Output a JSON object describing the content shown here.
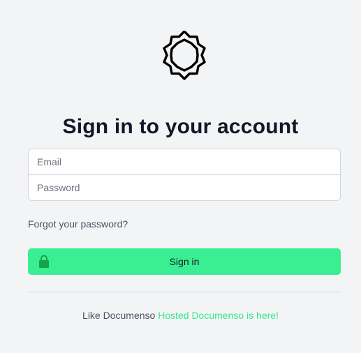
{
  "logo": {
    "icon": "documenso-logo-icon"
  },
  "title": "Sign in to your account",
  "form": {
    "email_placeholder": "Email",
    "password_placeholder": "Password",
    "forgot_password": "Forgot your password?",
    "submit_label": "Sign in",
    "submit_icon": "lock-icon"
  },
  "footer": {
    "prefix": "Like Documenso",
    "link": "Hosted Documenso is here!"
  },
  "colors": {
    "background": "#f3f4f6",
    "accent": "#3aef92",
    "link": "#37e88b",
    "title": "#111827"
  }
}
